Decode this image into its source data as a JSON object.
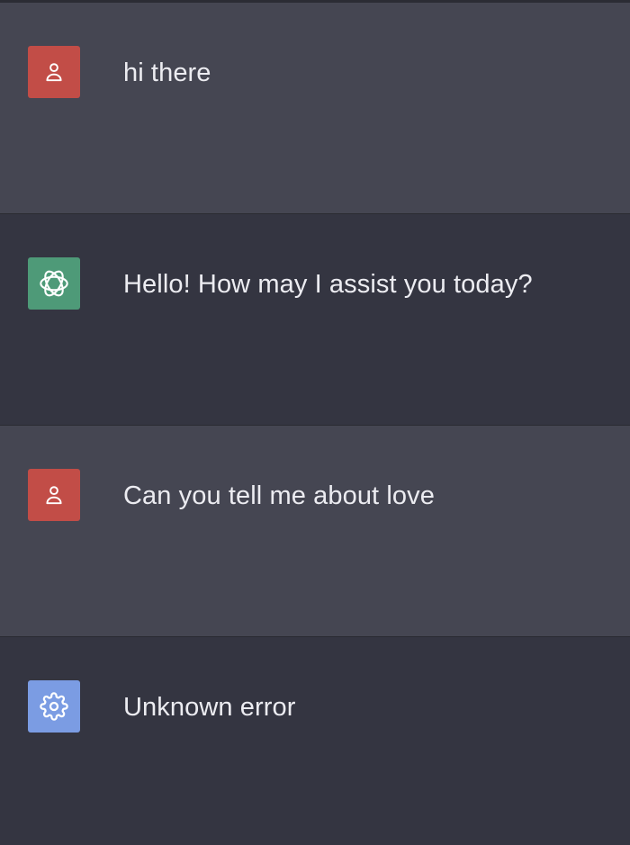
{
  "colors": {
    "user_avatar": "#c24d47",
    "assistant_avatar": "#4e9a78",
    "system_avatar": "#7b9ce3",
    "user_row": "#454652",
    "assistant_row": "#343541",
    "text": "#ececf1"
  },
  "messages": [
    {
      "role": "user",
      "icon": "user-icon",
      "text": "hi there"
    },
    {
      "role": "assistant",
      "icon": "assistant-logo-icon",
      "text": "Hello! How may I assist you today?"
    },
    {
      "role": "user",
      "icon": "user-icon",
      "text": "Can you tell me about love"
    },
    {
      "role": "system",
      "icon": "gear-icon",
      "text": "Unknown error"
    }
  ]
}
